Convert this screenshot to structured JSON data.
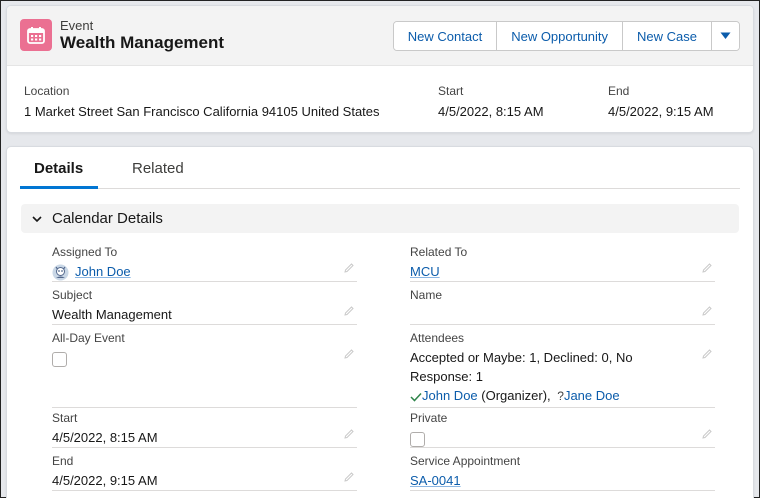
{
  "header": {
    "object_type": "Event",
    "record_name": "Wealth Management",
    "buttons": [
      "New Contact",
      "New Opportunity",
      "New Case"
    ],
    "icon": "calendar-icon",
    "icon_color": "#eb7092",
    "highlights": {
      "location_label": "Location",
      "location_value": "1 Market Street San Francisco California 94105 United States",
      "start_label": "Start",
      "start_value": "4/5/2022, 8:15 AM",
      "end_label": "End",
      "end_value": "4/5/2022, 9:15 AM"
    }
  },
  "tabs": [
    "Details",
    "Related"
  ],
  "active_tab": "Details",
  "section": {
    "title": "Calendar Details",
    "expanded": true
  },
  "fields": {
    "assigned_to": {
      "label": "Assigned To",
      "value": "John Doe"
    },
    "related_to": {
      "label": "Related To",
      "value": "MCU"
    },
    "subject": {
      "label": "Subject",
      "value": "Wealth Management"
    },
    "name": {
      "label": "Name",
      "value": ""
    },
    "all_day": {
      "label": "All-Day Event",
      "checked": false
    },
    "attendees": {
      "label": "Attendees",
      "summary_line1": "Accepted or Maybe: 1, Declined: 0, No",
      "summary_line2": "Response: 1",
      "organizer_name": "John Doe",
      "organizer_suffix": "(Organizer),",
      "other_name": "Jane Doe"
    },
    "start": {
      "label": "Start",
      "value": "4/5/2022, 8:15 AM"
    },
    "private": {
      "label": "Private",
      "checked": false
    },
    "end": {
      "label": "End",
      "value": "4/5/2022, 9:15 AM"
    },
    "service_appointment": {
      "label": "Service Appointment",
      "value": "SA-0041"
    }
  },
  "colors": {
    "link": "#0b5cab",
    "tab_indicator": "#0176d3",
    "accepted_check": "#2e844a"
  }
}
